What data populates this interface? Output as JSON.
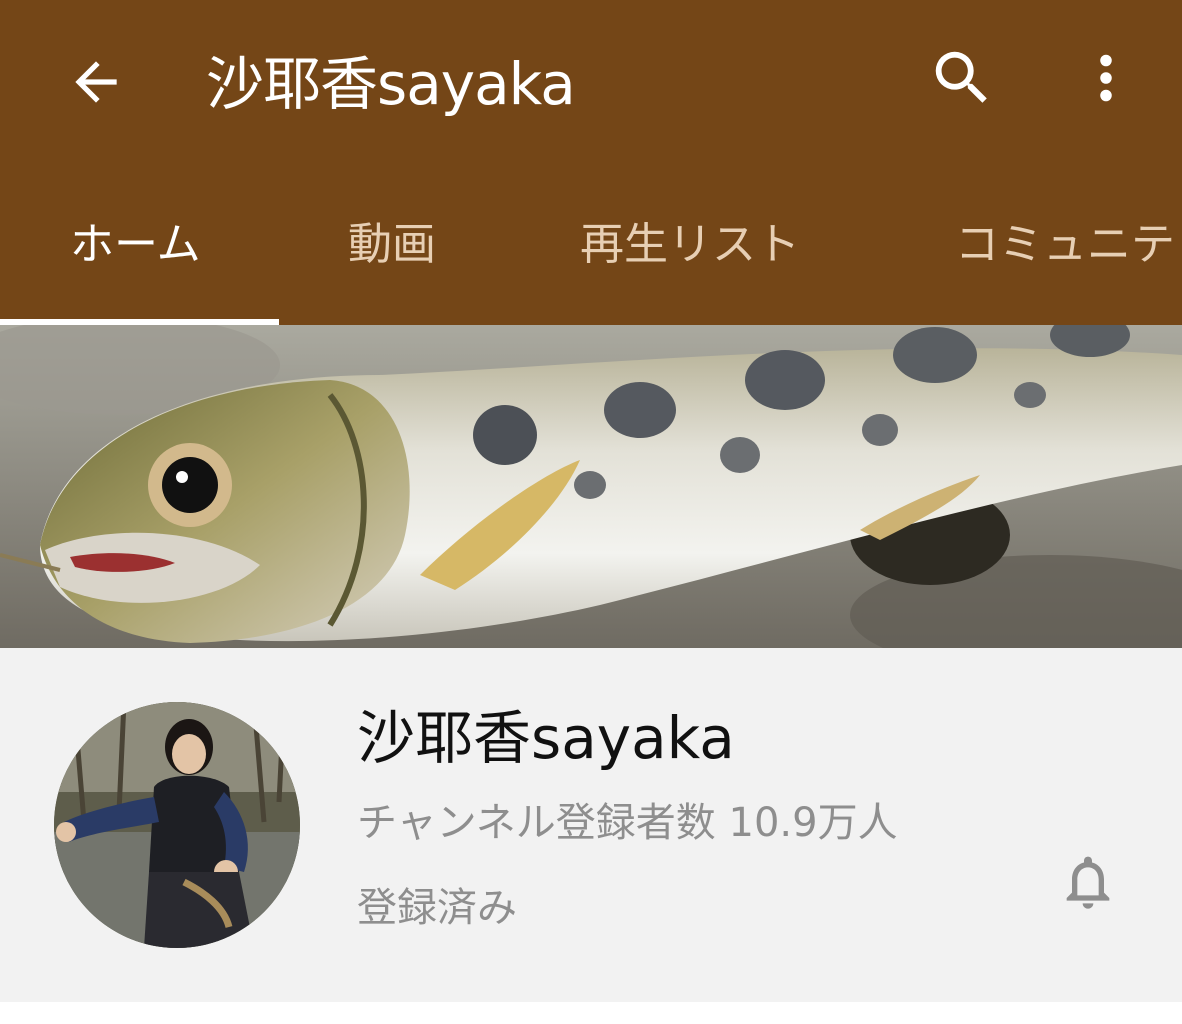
{
  "appbar": {
    "back_icon": "arrow-back-icon",
    "title": "沙耶香sayaka",
    "search_icon": "search-icon",
    "more_icon": "more-vert-icon",
    "background_color": "#744617",
    "foreground_color": "#ffffff"
  },
  "tabs": [
    {
      "label": "ホーム",
      "active": true
    },
    {
      "label": "動画",
      "active": false
    },
    {
      "label": "再生リスト",
      "active": false
    },
    {
      "label": "コミュニテ",
      "active": false
    }
  ],
  "banner": {
    "description": "trout-photo"
  },
  "channel": {
    "name": "沙耶香sayaka",
    "subscribers": "チャンネル登録者数 10.9万人",
    "subscription_status": "登録済み",
    "notification_icon": "bell-icon",
    "muted_text_color": "#8e8e8e"
  }
}
